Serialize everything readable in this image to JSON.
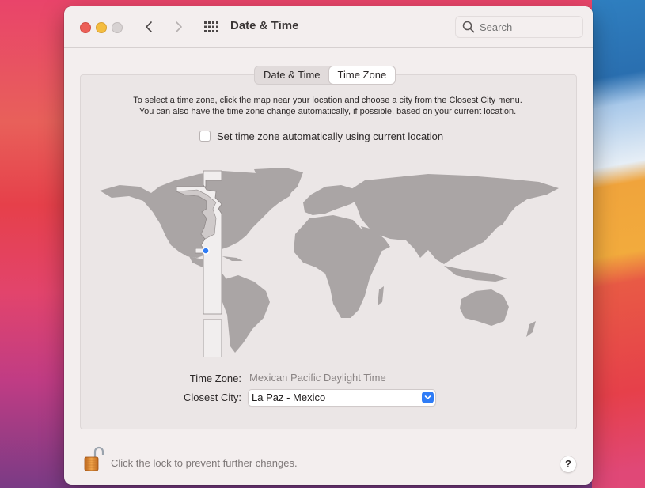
{
  "window": {
    "title": "Date & Time",
    "search_placeholder": "Search"
  },
  "tabs": [
    {
      "label": "Date & Time",
      "active": false
    },
    {
      "label": "Time Zone",
      "active": true
    }
  ],
  "time_zone_pane": {
    "instructions_line1": "To select a time zone, click the map near your location and choose a city from the Closest City menu.",
    "instructions_line2": "You can also have the time zone change automatically, if possible, based on your current location.",
    "auto_checkbox_label": "Set time zone automatically using current location",
    "auto_checkbox_checked": false,
    "time_zone_label": "Time Zone:",
    "time_zone_value": "Mexican Pacific Daylight Time",
    "closest_city_label": "Closest City:",
    "closest_city_value": "La Paz - Mexico"
  },
  "map": {
    "selected_location": "La Paz - Mexico",
    "marker_color": "#2f7cf6",
    "land_color": "#aaa5a5",
    "highlight_zone_color": "#f1eeee"
  },
  "footer": {
    "lock_text": "Click the lock to prevent further changes.",
    "lock_state": "unlocked",
    "help_label": "?"
  }
}
